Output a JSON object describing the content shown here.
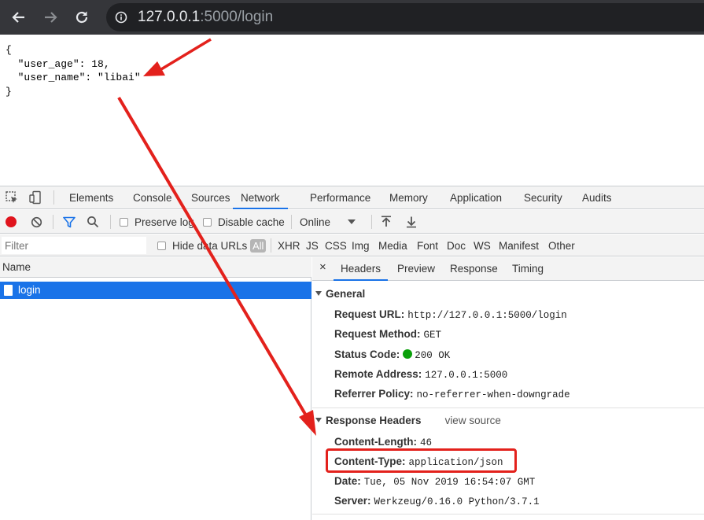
{
  "browser": {
    "url_host": "127.0.0.1",
    "url_rest": ":5000/login"
  },
  "json_lines": [
    "{",
    "  \"user_age\": 18,",
    "  \"user_name\": \"libai\"",
    "}"
  ],
  "devtools": {
    "tabs": [
      "Elements",
      "Console",
      "Sources",
      "Network",
      "Performance",
      "Memory",
      "Application",
      "Security",
      "Audits"
    ],
    "active_tab": "Network",
    "toolbar": {
      "preserve_log": "Preserve log",
      "disable_cache": "Disable cache",
      "throttle": "Online"
    },
    "filter": {
      "placeholder": "Filter",
      "hide_data_urls": "Hide data URLs",
      "types": [
        "All",
        "XHR",
        "JS",
        "CSS",
        "Img",
        "Media",
        "Font",
        "Doc",
        "WS",
        "Manifest",
        "Other"
      ]
    },
    "request_list": {
      "header": "Name",
      "rows": [
        "login"
      ]
    },
    "details": {
      "close": "×",
      "tabs": [
        "Headers",
        "Preview",
        "Response",
        "Timing"
      ],
      "active_tab": "Headers",
      "general": {
        "title": "General",
        "rows": [
          {
            "key": "Request URL:",
            "value": "http://127.0.0.1:5000/login"
          },
          {
            "key": "Request Method:",
            "value": "GET"
          },
          {
            "key": "Status Code:",
            "value": "200 OK"
          },
          {
            "key": "Remote Address:",
            "value": "127.0.0.1:5000"
          },
          {
            "key": "Referrer Policy:",
            "value": "no-referrer-when-downgrade"
          }
        ]
      },
      "response_headers": {
        "title": "Response Headers",
        "view_source": "view source",
        "rows": [
          {
            "key": "Content-Length:",
            "value": "46"
          },
          {
            "key": "Content-Type:",
            "value": "application/json"
          },
          {
            "key": "Date:",
            "value": "Tue, 05 Nov 2019 16:54:07 GMT"
          },
          {
            "key": "Server:",
            "value": "Werkzeug/0.16.0 Python/3.7.1"
          }
        ]
      }
    }
  },
  "colors": {
    "accent": "#1a73e8",
    "annotation": "#e3211c",
    "status_ok": "#0aa00a"
  }
}
